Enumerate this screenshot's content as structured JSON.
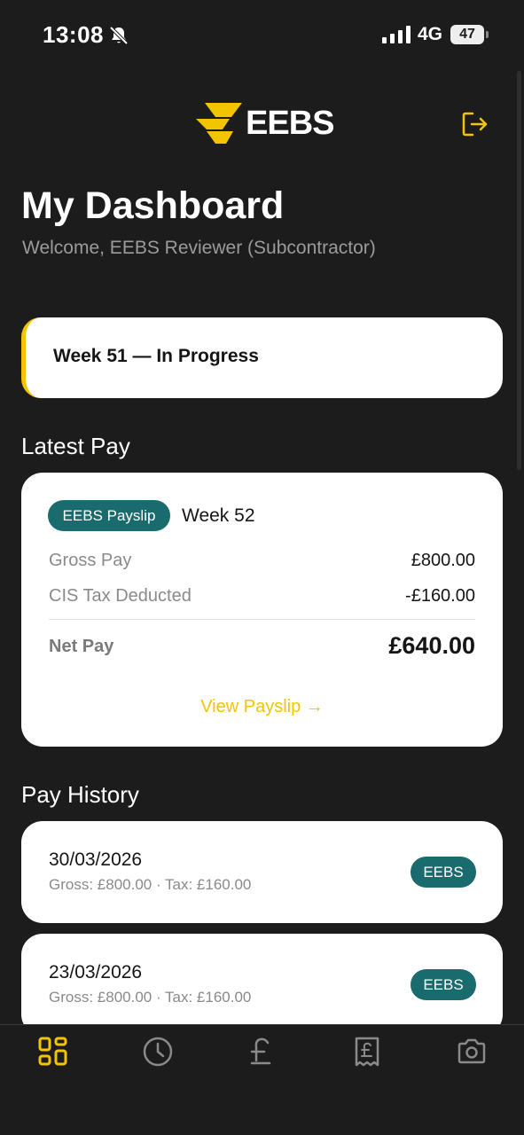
{
  "status_bar": {
    "time": "13:08",
    "network": "4G",
    "battery": "47",
    "icons": [
      "bell-slash-icon",
      "signal-icon"
    ]
  },
  "header": {
    "logo_text": "EEBS",
    "logout_icon": "logout-icon"
  },
  "page": {
    "title": "My Dashboard",
    "welcome": "Welcome, EEBS Reviewer (Subcontractor)"
  },
  "week_status": {
    "label": "Week 51 — In Progress"
  },
  "latest_pay": {
    "section_title": "Latest Pay",
    "badge": "EEBS Payslip",
    "week": "Week 52",
    "rows": [
      {
        "label": "Gross Pay",
        "value": "£800.00"
      },
      {
        "label": "CIS Tax Deducted",
        "value": "-£160.00"
      }
    ],
    "net_label": "Net Pay",
    "net_value": "£640.00",
    "link": "View Payslip →"
  },
  "pay_history": {
    "section_title": "Pay History",
    "items": [
      {
        "date": "30/03/2026",
        "detail": "Gross: £800.00 · Tax: £160.00",
        "badge": "EEBS"
      },
      {
        "date": "23/03/2026",
        "detail": "Gross: £800.00 · Tax: £160.00",
        "badge": "EEBS"
      }
    ]
  },
  "bottom_nav": {
    "items": [
      "dashboard-icon",
      "clock-icon",
      "pound-icon",
      "receipt-icon",
      "camera-icon"
    ],
    "active": "dashboard-icon"
  },
  "colors": {
    "background": "#1c1c1c",
    "accent": "#f3c400",
    "teal": "#1a6b6e",
    "card": "#ffffff"
  }
}
